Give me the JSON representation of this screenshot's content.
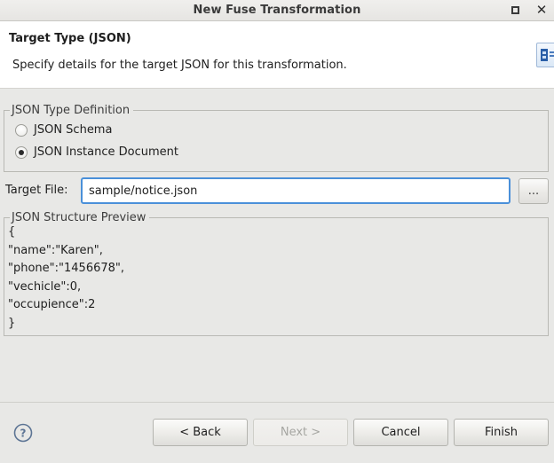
{
  "window": {
    "title": "New Fuse Transformation",
    "titlebar_buttons": [
      {
        "name": "maximize",
        "label": "□"
      },
      {
        "name": "close",
        "label": "✕"
      }
    ]
  },
  "header": {
    "title": "Target Type (JSON)",
    "description": "Specify details for the target JSON for this transformation.",
    "banner_icon": "wizard-banner-icon"
  },
  "type_definition": {
    "legend": "JSON Type Definition",
    "options": [
      {
        "label": "JSON Schema",
        "selected": false
      },
      {
        "label": "JSON Instance Document",
        "selected": true
      }
    ]
  },
  "target_file": {
    "label": "Target File:",
    "value": "sample/notice.json",
    "placeholder": "",
    "browse_label": "..."
  },
  "preview": {
    "legend": "JSON Structure Preview",
    "content": "{\n\"name\":\"Karen\",\n\"phone\":\"1456678\",\n\"vechicle\":0,\n\"occupience\":2\n}"
  },
  "footer": {
    "help_label": "?",
    "buttons": [
      {
        "label": "< Back",
        "enabled": true
      },
      {
        "label": "Next >",
        "enabled": false
      },
      {
        "label": "Cancel",
        "enabled": true
      },
      {
        "label": "Finish",
        "enabled": true
      }
    ]
  },
  "colors": {
    "focus_border": "#4a90d9",
    "window_bg": "#e8e8e6",
    "header_bg": "#ffffff",
    "help_icon": "#5c7494"
  }
}
